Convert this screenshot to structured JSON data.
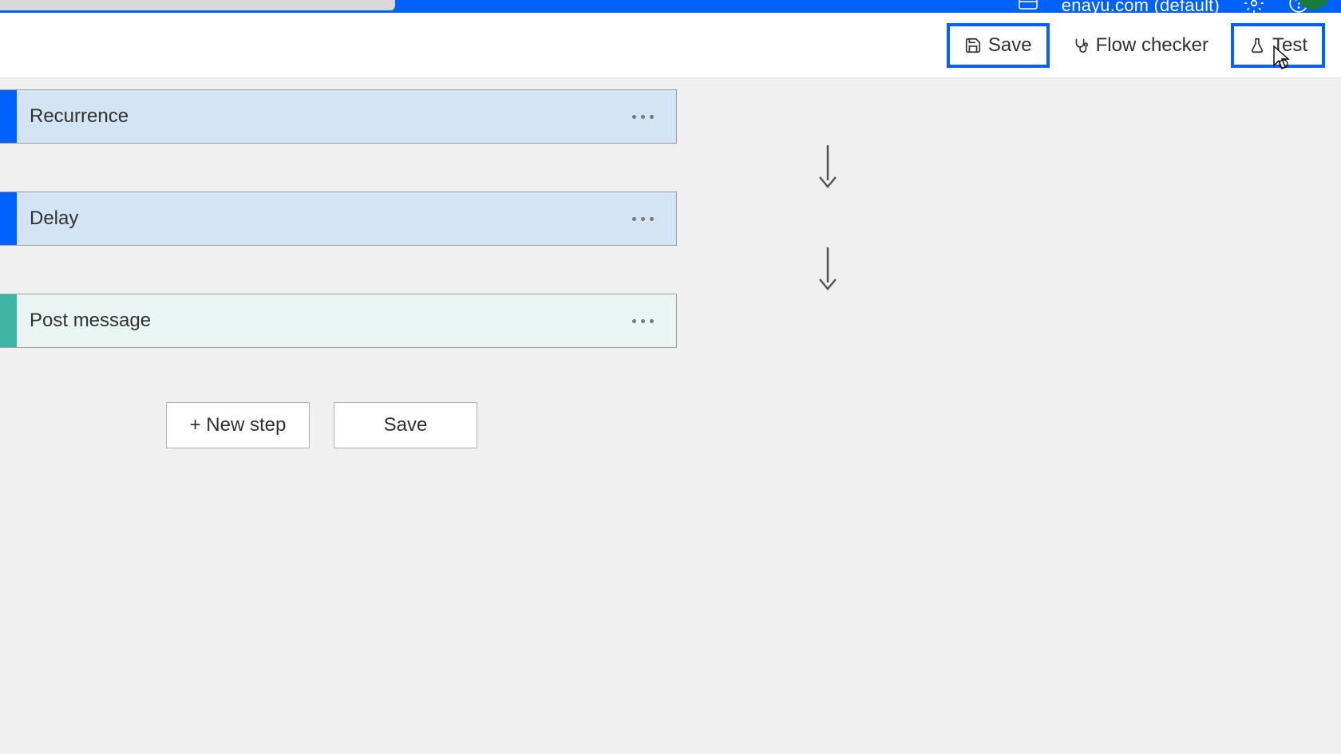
{
  "header": {
    "tenant_label": "enayu.com (default)"
  },
  "toolbar": {
    "save_label": "Save",
    "flow_checker_label": "Flow checker",
    "test_label": "Test"
  },
  "flow": {
    "steps": [
      {
        "title": "Recurrence",
        "color": "blue",
        "body": "light-blue"
      },
      {
        "title": "Delay",
        "color": "blue",
        "body": "light-blue"
      },
      {
        "title": "Post message",
        "color": "teal",
        "body": "light-teal"
      }
    ]
  },
  "bottom": {
    "new_step_label": "+ New step",
    "save_label": "Save"
  }
}
